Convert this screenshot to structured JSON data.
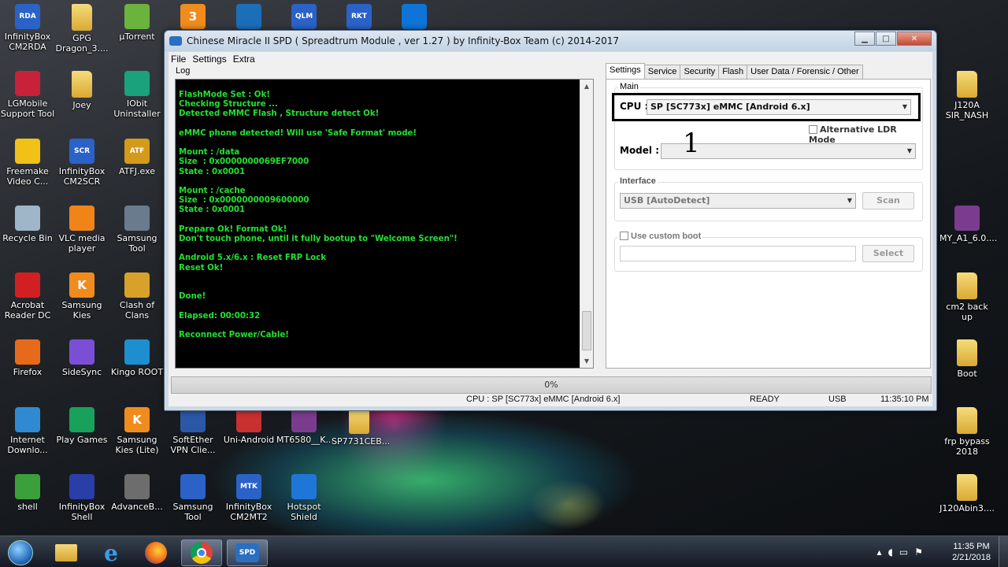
{
  "desktop_icons": [
    {
      "label": "InfinityBox\nCM2RDA",
      "icon": "infinitybox-cm2rda-icon",
      "badge": "RDA",
      "color": "#2a62c8"
    },
    {
      "label": "GPG\nDragon_3....",
      "icon": "folder-icon",
      "badge": "",
      "color": "#e5bb4a"
    },
    {
      "label": "μTorrent",
      "icon": "utorrent-icon",
      "badge": "",
      "color": "#6cb33e"
    },
    {
      "label": "",
      "icon": "kies-icon",
      "badge": "3",
      "color": "#f08c1d"
    },
    {
      "label": "",
      "icon": "anchor-icon",
      "badge": "",
      "color": "#1b6fb8"
    },
    {
      "label": "",
      "icon": "infinitybox-qlm-icon",
      "badge": "QLM",
      "color": "#2a62c8"
    },
    {
      "label": "",
      "icon": "infinitybox-rkt-icon",
      "badge": "RKT",
      "color": "#2a62c8"
    },
    {
      "label": "",
      "icon": "teamviewer-icon",
      "badge": "",
      "color": "#0e74d8"
    },
    {
      "label": "LGMobile\nSupport Tool",
      "icon": "lg-icon",
      "badge": "",
      "color": "#c8213a"
    },
    {
      "label": "Joey",
      "icon": "folder-icon",
      "badge": "",
      "color": "#e5bb4a"
    },
    {
      "label": "IObit\nUninstaller",
      "icon": "iobit-icon",
      "badge": "",
      "color": "#1aa27c"
    },
    {
      "label": "Freemake\nVideo C...",
      "icon": "freemake-icon",
      "badge": "",
      "color": "#f2c118"
    },
    {
      "label": "InfinityBox\nCM2SCR",
      "icon": "infinitybox-cm2scr-icon",
      "badge": "SCR",
      "color": "#2a62c8"
    },
    {
      "label": "ATFJ.exe",
      "icon": "atf-icon",
      "badge": "ATF",
      "color": "#d49a1a"
    },
    {
      "label": "Recycle Bin",
      "icon": "recycle-bin-icon",
      "badge": "",
      "color": "#9fb6c8"
    },
    {
      "label": "VLC media\nplayer",
      "icon": "vlc-icon",
      "badge": "",
      "color": "#f08418"
    },
    {
      "label": "Samsung\nTool",
      "icon": "samsung-tool-icon",
      "badge": "",
      "color": "#6a7b8e"
    },
    {
      "label": "Acrobat\nReader DC",
      "icon": "acrobat-icon",
      "badge": "",
      "color": "#d21f22"
    },
    {
      "label": "Samsung\nKies",
      "icon": "kies-icon",
      "badge": "K",
      "color": "#f08c1d"
    },
    {
      "label": "Clash of\nClans",
      "icon": "clash-of-clans-icon",
      "badge": "",
      "color": "#d8a12a"
    },
    {
      "label": "Firefox",
      "icon": "firefox-icon",
      "badge": "",
      "color": "#e76a1b"
    },
    {
      "label": "SideSync",
      "icon": "sidesync-icon",
      "badge": "",
      "color": "#7a4fd6"
    },
    {
      "label": "Kingo ROOT",
      "icon": "kingo-root-icon",
      "badge": "",
      "color": "#1d8fd0"
    },
    {
      "label": "Internet\nDownlo...",
      "icon": "idm-icon",
      "badge": "",
      "color": "#2f8ad2"
    },
    {
      "label": "Play Games",
      "icon": "play-games-icon",
      "badge": "",
      "color": "#19a05b"
    },
    {
      "label": "Samsung\nKies (Lite)",
      "icon": "kies-lite-icon",
      "badge": "K",
      "color": "#f08c1d"
    },
    {
      "label": "SoftEther\nVPN Clie...",
      "icon": "softether-icon",
      "badge": "",
      "color": "#2b58a6"
    },
    {
      "label": "Uni-Android",
      "icon": "uni-android-icon",
      "badge": "",
      "color": "#c93030"
    },
    {
      "label": "MT6580__K...",
      "icon": "winrar-icon",
      "badge": "",
      "color": "#7b3c8f"
    },
    {
      "label": "SP7731CEB...",
      "icon": "folder-icon",
      "badge": "",
      "color": "#e5bb4a"
    },
    {
      "label": "shell",
      "icon": "shell-icon",
      "badge": "",
      "color": "#3b9f3b"
    },
    {
      "label": "InfinityBox\nShell",
      "icon": "infinitybox-shell-icon",
      "badge": "",
      "color": "#2a3ea8"
    },
    {
      "label": "AdvanceB...",
      "icon": "advanceb-icon",
      "badge": "",
      "color": "#6d6d6d"
    },
    {
      "label": "Samsung\nTool",
      "icon": "samsung-tool-icon",
      "badge": "",
      "color": "#2a62c8"
    },
    {
      "label": "InfinityBox\nCM2MT2",
      "icon": "infinitybox-cm2mt2-icon",
      "badge": "MTK",
      "color": "#2a62c8"
    },
    {
      "label": "Hotspot\nShield",
      "icon": "hotspot-shield-icon",
      "badge": "",
      "color": "#1e76d9"
    },
    {
      "label": "J120A\nSIR_NASH",
      "icon": "folder-icon",
      "badge": "",
      "color": "#e5bb4a"
    },
    {
      "label": "MY_A1_6.0....",
      "icon": "winrar-icon",
      "badge": "",
      "color": "#7b3c8f"
    },
    {
      "label": "cm2 back up",
      "icon": "folder-icon",
      "badge": "",
      "color": "#e5bb4a"
    },
    {
      "label": "Boot",
      "icon": "folder-icon",
      "badge": "",
      "color": "#e5bb4a"
    },
    {
      "label": "frp bypass\n2018",
      "icon": "folder-icon",
      "badge": "",
      "color": "#e5bb4a"
    },
    {
      "label": "J120Abin3....",
      "icon": "folder-icon",
      "badge": "",
      "color": "#e5bb4a"
    }
  ],
  "window": {
    "title": "Chinese Miracle II SPD ( Spreadtrum Module , ver 1.27 ) by Infinity-Box Team (c) 2014-2017",
    "menu": [
      "File",
      "Settings",
      "Extra"
    ],
    "log_label": "Log",
    "log_lines": [
      "FlashMode Set : Ok!",
      "Checking Structure ...",
      "Detected eMMC Flash , Structure detect Ok!",
      "",
      "eMMC phone detected! Will use 'Safe Format' mode!",
      "",
      "Mount : /data",
      "Size  : 0x0000000069EF7000",
      "State : 0x0001",
      "",
      "Mount : /cache",
      "Size  : 0x0000000009600000",
      "State : 0x0001",
      "",
      "Prepare Ok! Format Ok!",
      "Don't touch phone, until it fully bootup to \"Welcome Screen\"!",
      "",
      "Android 5.x/6.x : Reset FRP Lock",
      "Reset Ok!",
      "",
      "",
      "Done!",
      "",
      "Elapsed: 00:00:32",
      "",
      "Reconnect Power/Cable!"
    ],
    "tabs": [
      "Settings",
      "Service",
      "Security",
      "Flash",
      "User Data / Forensic / Other"
    ],
    "main_group": "Main",
    "cpu_label": "CPU :",
    "cpu_value": "SP [SC773x] eMMC [Android 6.x]",
    "alt_ldr": "Alternative LDR Mode",
    "model_label": "Model :",
    "model_annotation": "1",
    "interface_group": "Interface",
    "interface_value": "USB [AutoDetect]",
    "scan": "Scan",
    "custom_boot": "Use custom boot",
    "select": "Select",
    "progress": "0%",
    "status": {
      "cpu": "CPU : SP [SC773x] eMMC [Android 6.x]",
      "state": "READY",
      "port": "USB",
      "time": "11:35:10 PM"
    }
  },
  "taskbar": {
    "buttons": [
      {
        "icon": "start-orb-icon"
      },
      {
        "icon": "file-explorer-icon"
      },
      {
        "icon": "internet-explorer-icon"
      },
      {
        "icon": "firefox-icon"
      },
      {
        "icon": "chrome-icon"
      },
      {
        "icon": "spd-tool-icon",
        "label": "SPD"
      }
    ],
    "clock_time": "11:35 PM",
    "clock_date": "2/21/2018"
  }
}
